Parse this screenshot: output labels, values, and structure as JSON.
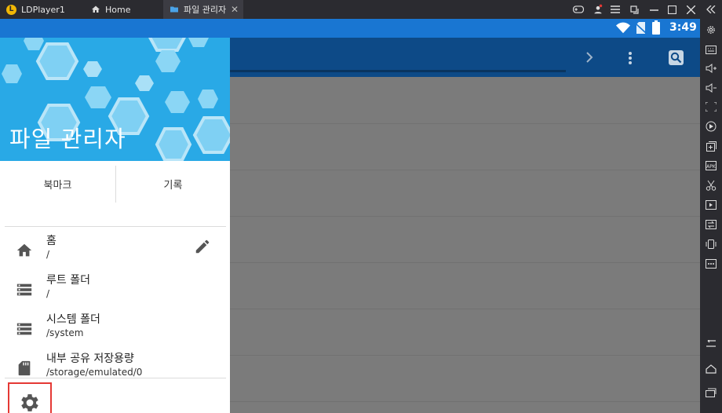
{
  "window": {
    "app_tab": "LDPlayer1",
    "tabs": [
      {
        "label": "Home"
      },
      {
        "label": "파일 관리자"
      }
    ]
  },
  "status": {
    "time": "3:49"
  },
  "drawer": {
    "title": "파일 관리자",
    "segments": [
      "북마크",
      "기록"
    ],
    "items": [
      {
        "name": "홈",
        "path": "/",
        "icon": "home-icon"
      },
      {
        "name": "루트 폴더",
        "path": "/",
        "icon": "storage-list-icon"
      },
      {
        "name": "시스템 폴더",
        "path": "/system",
        "icon": "storage-list-icon"
      },
      {
        "name": "내부 공유 저장용량",
        "path": "/storage/emulated/0",
        "icon": "sd-card-icon"
      }
    ]
  },
  "colors": {
    "status_bar": "#1976d2",
    "app_bar": "#0d4a87",
    "drawer_header": "#29a9e6",
    "highlight_box": "#e53935"
  },
  "icons": [
    "chevron-right-icon",
    "more-vert-icon",
    "search-icon",
    "pencil-icon",
    "settings-gear-icon",
    "wifi-icon",
    "no-sim-icon",
    "battery-icon"
  ]
}
